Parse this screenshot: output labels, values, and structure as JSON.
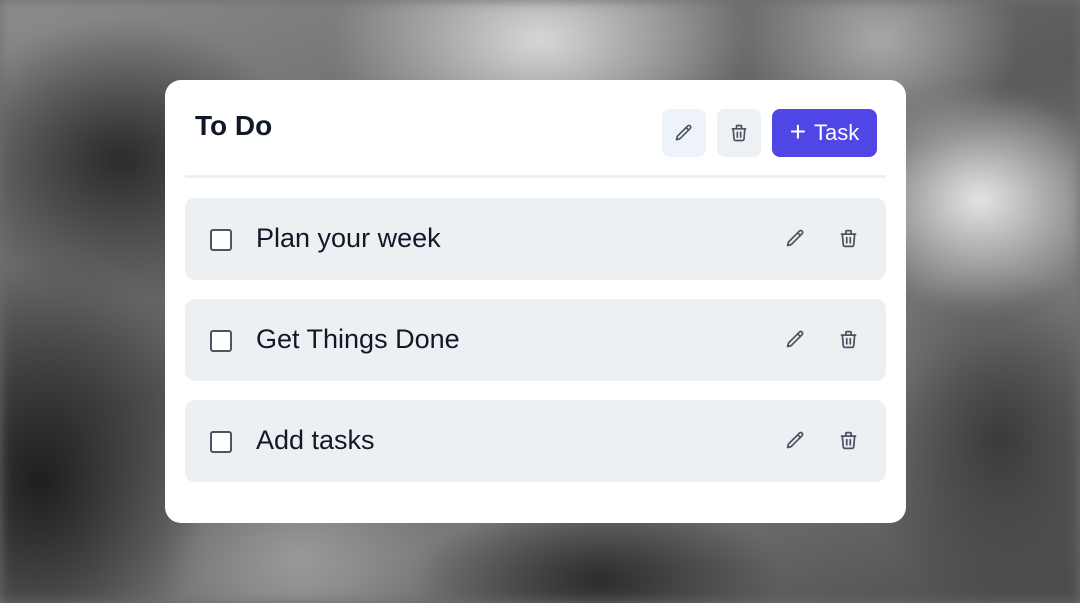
{
  "card": {
    "title": "To Do",
    "add_button_label": "Task",
    "header_icons": [
      "pencil-icon",
      "trash-icon",
      "plus-icon"
    ]
  },
  "tasks": [
    {
      "label": "Plan your week",
      "checked": false
    },
    {
      "label": "Get Things Done",
      "checked": false
    },
    {
      "label": "Add tasks",
      "checked": false
    }
  ],
  "colors": {
    "accent": "#4f46e5",
    "card_background": "#ffffff",
    "task_background": "#edf0f3",
    "text": "#111827",
    "icon": "#4b5563"
  }
}
